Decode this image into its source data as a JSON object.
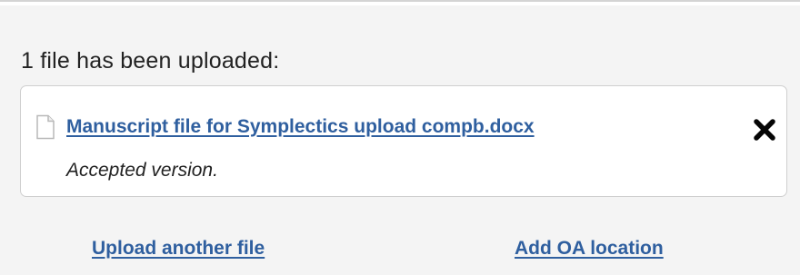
{
  "upload": {
    "heading": "1 file has been uploaded:",
    "files": [
      {
        "name": "Manuscript file for Symplectics upload compb.docx",
        "version": "Accepted version.",
        "icon": "document-icon",
        "remove_icon": "close-icon"
      }
    ],
    "actions": {
      "upload_another": "Upload another file",
      "add_oa_location": "Add OA location"
    }
  },
  "colors": {
    "link": "#2f5f9f",
    "background": "#f4f4f4",
    "card": "#ffffff",
    "border": "#cfcfcf"
  }
}
